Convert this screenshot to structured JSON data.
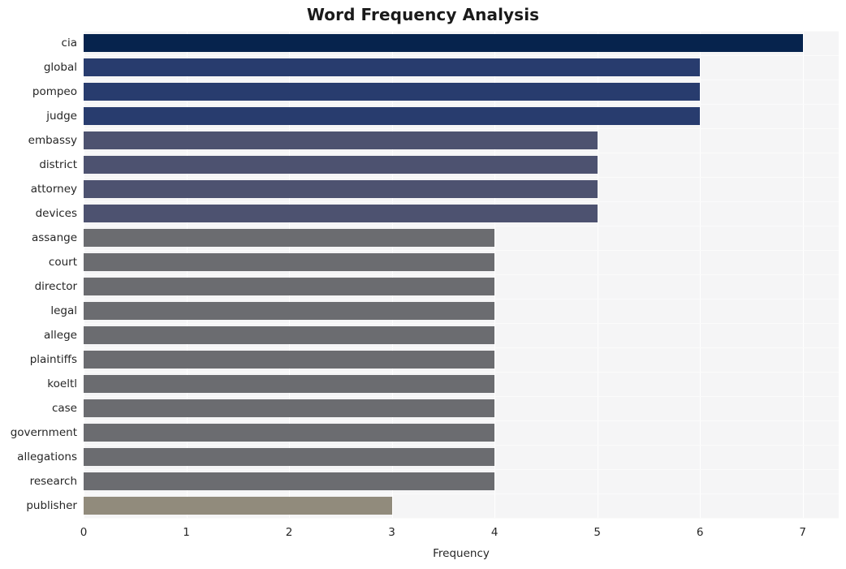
{
  "chart_data": {
    "type": "bar",
    "orientation": "horizontal",
    "title": "Word Frequency Analysis",
    "xlabel": "Frequency",
    "ylabel": "",
    "xlim": [
      0,
      7.35
    ],
    "ylim": [
      0,
      20
    ],
    "grid": true,
    "legend": false,
    "xticks": [
      0,
      1,
      2,
      3,
      4,
      5,
      6,
      7
    ],
    "xtick_labels": [
      "0",
      "1",
      "2",
      "3",
      "4",
      "5",
      "6",
      "7"
    ],
    "categories": [
      "cia",
      "global",
      "pompeo",
      "judge",
      "embassy",
      "district",
      "attorney",
      "devices",
      "assange",
      "court",
      "director",
      "legal",
      "allege",
      "plaintiffs",
      "koeltl",
      "case",
      "government",
      "allegations",
      "research",
      "publisher"
    ],
    "values": [
      7,
      6,
      6,
      6,
      5,
      5,
      5,
      5,
      4,
      4,
      4,
      4,
      4,
      4,
      4,
      4,
      4,
      4,
      4,
      3
    ],
    "bar_colors": [
      "#06234d",
      "#283c6e",
      "#283c6e",
      "#283c6e",
      "#4d5270",
      "#4d5270",
      "#4d5270",
      "#4d5270",
      "#6b6c70",
      "#6b6c70",
      "#6b6c70",
      "#6b6c70",
      "#6b6c70",
      "#6b6c70",
      "#6b6c70",
      "#6b6c70",
      "#6b6c70",
      "#6b6c70",
      "#6b6c70",
      "#918b7c"
    ]
  },
  "style": {
    "figure_background": "#ffffff",
    "plot_background": "#f5f5f6",
    "gridline_color": "#ffffff",
    "text_color": "#262626",
    "title_color": "#1a1a1a"
  }
}
